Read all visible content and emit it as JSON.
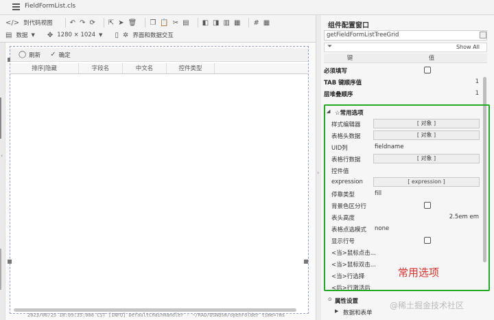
{
  "window": {
    "tab_title": "FieldFormList.cls"
  },
  "toolbar": {
    "switch_view_label": "到代码视图",
    "data_label": "数据",
    "resolution_label": "1280 × 1024",
    "interaction_label": "界面和数据交互"
  },
  "designer": {
    "refresh_label": "刷新",
    "confirm_label": "确定",
    "columns": [
      "排序|隐藏",
      "字段名",
      "中文名",
      "控件类型"
    ]
  },
  "log": {
    "line": "2023/06/25 18:09:35:088 CST [INFO] DefaultChainHandler - ~/RAD/DSNdsm/openFolder time=?ms"
  },
  "panel": {
    "title": "组件配置窗口",
    "component": "getFieldFormListTreeGrid",
    "show_all": "Show All",
    "header_key": "键",
    "header_value": "值",
    "top_rows": [
      {
        "key": "必须填写",
        "value": ""
      },
      {
        "key": "TAB 键顺序值",
        "value": "1"
      },
      {
        "key": "层堆叠顺序",
        "value": "1"
      }
    ],
    "group_common": {
      "label": "☆常用选项",
      "rows": [
        {
          "key": "样式编辑器",
          "value": "[ 对象 ]"
        },
        {
          "key": "表格头数据",
          "value": "[ 对象 ]"
        },
        {
          "key": "UID列",
          "value": "fieldname"
        },
        {
          "key": "表格行数据",
          "value": "[ 对象 ]"
        },
        {
          "key": "控件值",
          "value": ""
        },
        {
          "key": "expression",
          "value": "[ expression ]"
        },
        {
          "key": "停靠类型",
          "value": "fill"
        },
        {
          "key": "背景色区分行",
          "value": ""
        },
        {
          "key": "表头高度",
          "value": "2.5em em"
        },
        {
          "key": "表格点选模式",
          "value": "none"
        },
        {
          "key": "显示行号",
          "value": ""
        },
        {
          "key": "<当>鼠标点击...",
          "value": ""
        },
        {
          "key": "<当>鼠标双击...",
          "value": ""
        },
        {
          "key": "<当>行选择",
          "value": ""
        },
        {
          "key": "<后>行激活后",
          "value": ""
        }
      ]
    },
    "group_props": {
      "label": "属性设置"
    },
    "sub_data": {
      "label": "数据和表单"
    }
  },
  "annotation": {
    "text": "常用选项"
  },
  "watermark": {
    "text": "@稀土掘金技术社区"
  }
}
